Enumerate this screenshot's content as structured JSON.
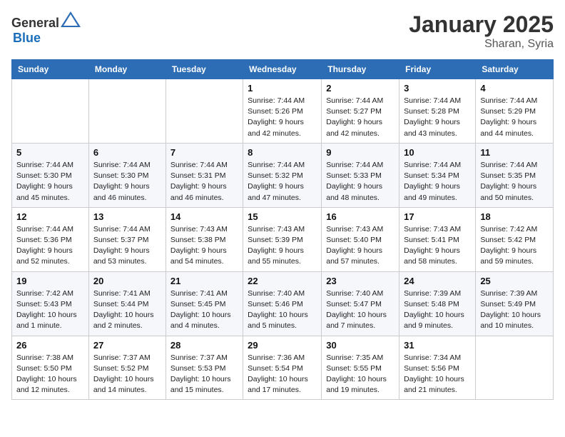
{
  "header": {
    "logo_general": "General",
    "logo_blue": "Blue",
    "month": "January 2025",
    "location": "Sharan, Syria"
  },
  "weekdays": [
    "Sunday",
    "Monday",
    "Tuesday",
    "Wednesday",
    "Thursday",
    "Friday",
    "Saturday"
  ],
  "weeks": [
    [
      {
        "day": "",
        "info": ""
      },
      {
        "day": "",
        "info": ""
      },
      {
        "day": "",
        "info": ""
      },
      {
        "day": "1",
        "info": "Sunrise: 7:44 AM\nSunset: 5:26 PM\nDaylight: 9 hours\nand 42 minutes."
      },
      {
        "day": "2",
        "info": "Sunrise: 7:44 AM\nSunset: 5:27 PM\nDaylight: 9 hours\nand 42 minutes."
      },
      {
        "day": "3",
        "info": "Sunrise: 7:44 AM\nSunset: 5:28 PM\nDaylight: 9 hours\nand 43 minutes."
      },
      {
        "day": "4",
        "info": "Sunrise: 7:44 AM\nSunset: 5:29 PM\nDaylight: 9 hours\nand 44 minutes."
      }
    ],
    [
      {
        "day": "5",
        "info": "Sunrise: 7:44 AM\nSunset: 5:30 PM\nDaylight: 9 hours\nand 45 minutes."
      },
      {
        "day": "6",
        "info": "Sunrise: 7:44 AM\nSunset: 5:30 PM\nDaylight: 9 hours\nand 46 minutes."
      },
      {
        "day": "7",
        "info": "Sunrise: 7:44 AM\nSunset: 5:31 PM\nDaylight: 9 hours\nand 46 minutes."
      },
      {
        "day": "8",
        "info": "Sunrise: 7:44 AM\nSunset: 5:32 PM\nDaylight: 9 hours\nand 47 minutes."
      },
      {
        "day": "9",
        "info": "Sunrise: 7:44 AM\nSunset: 5:33 PM\nDaylight: 9 hours\nand 48 minutes."
      },
      {
        "day": "10",
        "info": "Sunrise: 7:44 AM\nSunset: 5:34 PM\nDaylight: 9 hours\nand 49 minutes."
      },
      {
        "day": "11",
        "info": "Sunrise: 7:44 AM\nSunset: 5:35 PM\nDaylight: 9 hours\nand 50 minutes."
      }
    ],
    [
      {
        "day": "12",
        "info": "Sunrise: 7:44 AM\nSunset: 5:36 PM\nDaylight: 9 hours\nand 52 minutes."
      },
      {
        "day": "13",
        "info": "Sunrise: 7:44 AM\nSunset: 5:37 PM\nDaylight: 9 hours\nand 53 minutes."
      },
      {
        "day": "14",
        "info": "Sunrise: 7:43 AM\nSunset: 5:38 PM\nDaylight: 9 hours\nand 54 minutes."
      },
      {
        "day": "15",
        "info": "Sunrise: 7:43 AM\nSunset: 5:39 PM\nDaylight: 9 hours\nand 55 minutes."
      },
      {
        "day": "16",
        "info": "Sunrise: 7:43 AM\nSunset: 5:40 PM\nDaylight: 9 hours\nand 57 minutes."
      },
      {
        "day": "17",
        "info": "Sunrise: 7:43 AM\nSunset: 5:41 PM\nDaylight: 9 hours\nand 58 minutes."
      },
      {
        "day": "18",
        "info": "Sunrise: 7:42 AM\nSunset: 5:42 PM\nDaylight: 9 hours\nand 59 minutes."
      }
    ],
    [
      {
        "day": "19",
        "info": "Sunrise: 7:42 AM\nSunset: 5:43 PM\nDaylight: 10 hours\nand 1 minute."
      },
      {
        "day": "20",
        "info": "Sunrise: 7:41 AM\nSunset: 5:44 PM\nDaylight: 10 hours\nand 2 minutes."
      },
      {
        "day": "21",
        "info": "Sunrise: 7:41 AM\nSunset: 5:45 PM\nDaylight: 10 hours\nand 4 minutes."
      },
      {
        "day": "22",
        "info": "Sunrise: 7:40 AM\nSunset: 5:46 PM\nDaylight: 10 hours\nand 5 minutes."
      },
      {
        "day": "23",
        "info": "Sunrise: 7:40 AM\nSunset: 5:47 PM\nDaylight: 10 hours\nand 7 minutes."
      },
      {
        "day": "24",
        "info": "Sunrise: 7:39 AM\nSunset: 5:48 PM\nDaylight: 10 hours\nand 9 minutes."
      },
      {
        "day": "25",
        "info": "Sunrise: 7:39 AM\nSunset: 5:49 PM\nDaylight: 10 hours\nand 10 minutes."
      }
    ],
    [
      {
        "day": "26",
        "info": "Sunrise: 7:38 AM\nSunset: 5:50 PM\nDaylight: 10 hours\nand 12 minutes."
      },
      {
        "day": "27",
        "info": "Sunrise: 7:37 AM\nSunset: 5:52 PM\nDaylight: 10 hours\nand 14 minutes."
      },
      {
        "day": "28",
        "info": "Sunrise: 7:37 AM\nSunset: 5:53 PM\nDaylight: 10 hours\nand 15 minutes."
      },
      {
        "day": "29",
        "info": "Sunrise: 7:36 AM\nSunset: 5:54 PM\nDaylight: 10 hours\nand 17 minutes."
      },
      {
        "day": "30",
        "info": "Sunrise: 7:35 AM\nSunset: 5:55 PM\nDaylight: 10 hours\nand 19 minutes."
      },
      {
        "day": "31",
        "info": "Sunrise: 7:34 AM\nSunset: 5:56 PM\nDaylight: 10 hours\nand 21 minutes."
      },
      {
        "day": "",
        "info": ""
      }
    ]
  ]
}
